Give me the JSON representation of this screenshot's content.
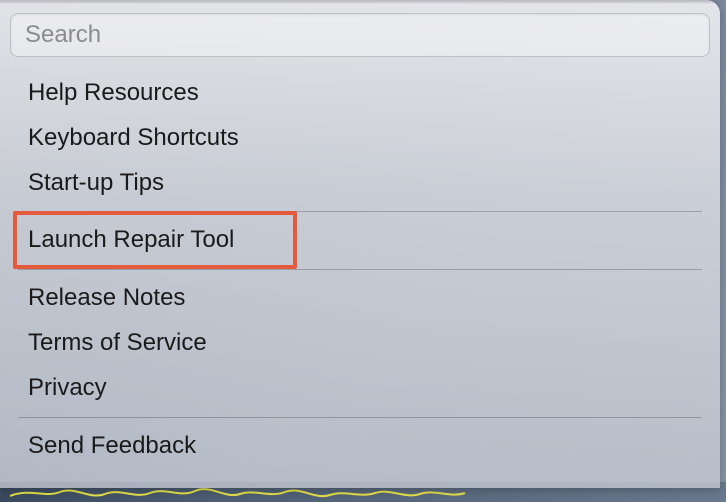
{
  "search": {
    "placeholder": "Search",
    "value": ""
  },
  "menu": {
    "group1": [
      "Help Resources",
      "Keyboard Shortcuts",
      "Start-up Tips"
    ],
    "group2": [
      "Launch Repair Tool"
    ],
    "group3": [
      "Release Notes",
      "Terms of Service",
      "Privacy"
    ],
    "group4": [
      "Send Feedback"
    ]
  },
  "highlight": {
    "target_label": "Launch Repair Tool",
    "color": "#e35a3c"
  }
}
